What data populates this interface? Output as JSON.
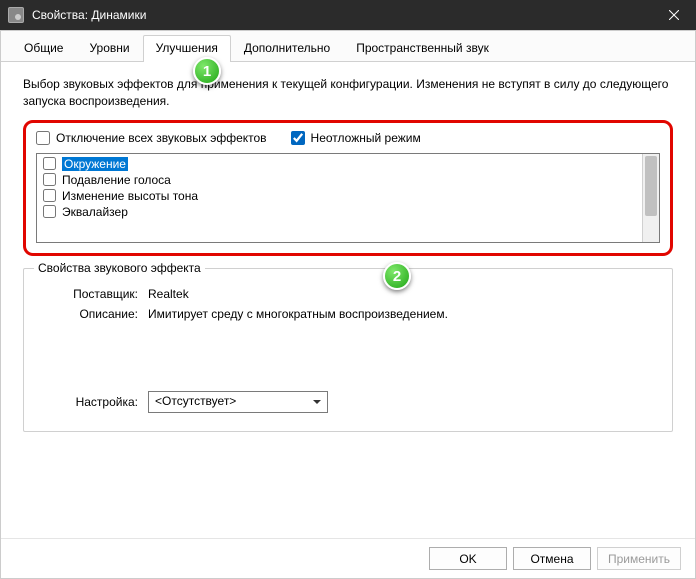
{
  "titlebar": {
    "title": "Свойства: Динамики"
  },
  "tabs": {
    "general": "Общие",
    "levels": "Уровни",
    "enhancements": "Улучшения",
    "advanced": "Дополнительно",
    "spatial": "Пространственный звук"
  },
  "description": "Выбор звуковых эффектов для применения к текущей конфигурации. Изменения не вступят в силу до следующего запуска воспроизведения.",
  "checkboxes": {
    "disable_all": "Отключение всех звуковых эффектов",
    "immediate": "Неотложный режим"
  },
  "effects": [
    "Окружение",
    "Подавление голоса",
    "Изменение высоты тона",
    "Эквалайзер"
  ],
  "group": {
    "title": "Свойства звукового эффекта",
    "provider_label": "Поставщик:",
    "provider_value": "Realtek",
    "desc_label": "Описание:",
    "desc_value": "Имитирует среду с многократным воспроизведением.",
    "setting_label": "Настройка:",
    "setting_value": "<Отсутствует>"
  },
  "buttons": {
    "ok": "OK",
    "cancel": "Отмена",
    "apply": "Применить"
  },
  "markers": {
    "1": "1",
    "2": "2"
  }
}
